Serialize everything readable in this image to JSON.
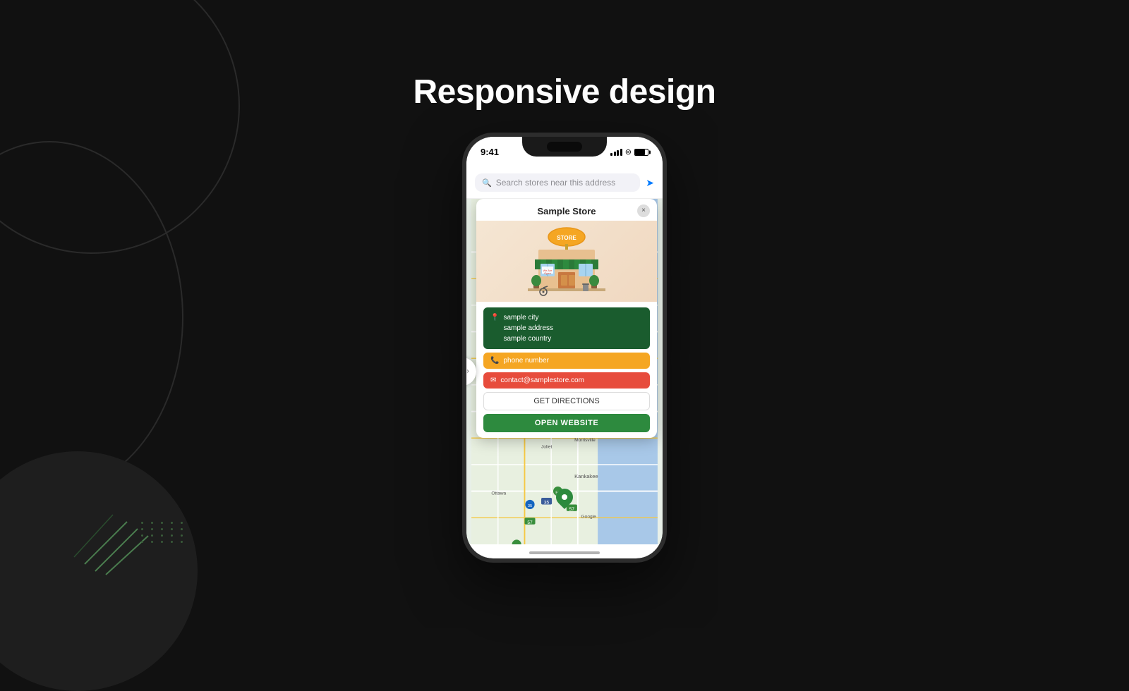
{
  "page": {
    "title": "Responsive design",
    "background_color": "#111111"
  },
  "phone": {
    "status_bar": {
      "time": "9:41",
      "signal": "signal",
      "wifi": "wifi",
      "battery": "battery"
    },
    "search": {
      "placeholder": "Search stores near this address"
    },
    "store_popup": {
      "title": "Sample Store",
      "close_label": "×",
      "address": {
        "city": "sample city",
        "street": "sample address",
        "country": "sample country"
      },
      "phone": "phone number",
      "email": "contact@samplestore.com",
      "directions_label": "GET DIRECTIONS",
      "website_label": "OPEN WEBSITE"
    },
    "map_controls": {
      "zoom_in": "+",
      "zoom_out": "−",
      "expand": "⤢"
    },
    "collapse_arrow": "›"
  },
  "decorations": {
    "green_lines_color": "#4a7c4e",
    "dots_color": "#3a5c3a"
  }
}
